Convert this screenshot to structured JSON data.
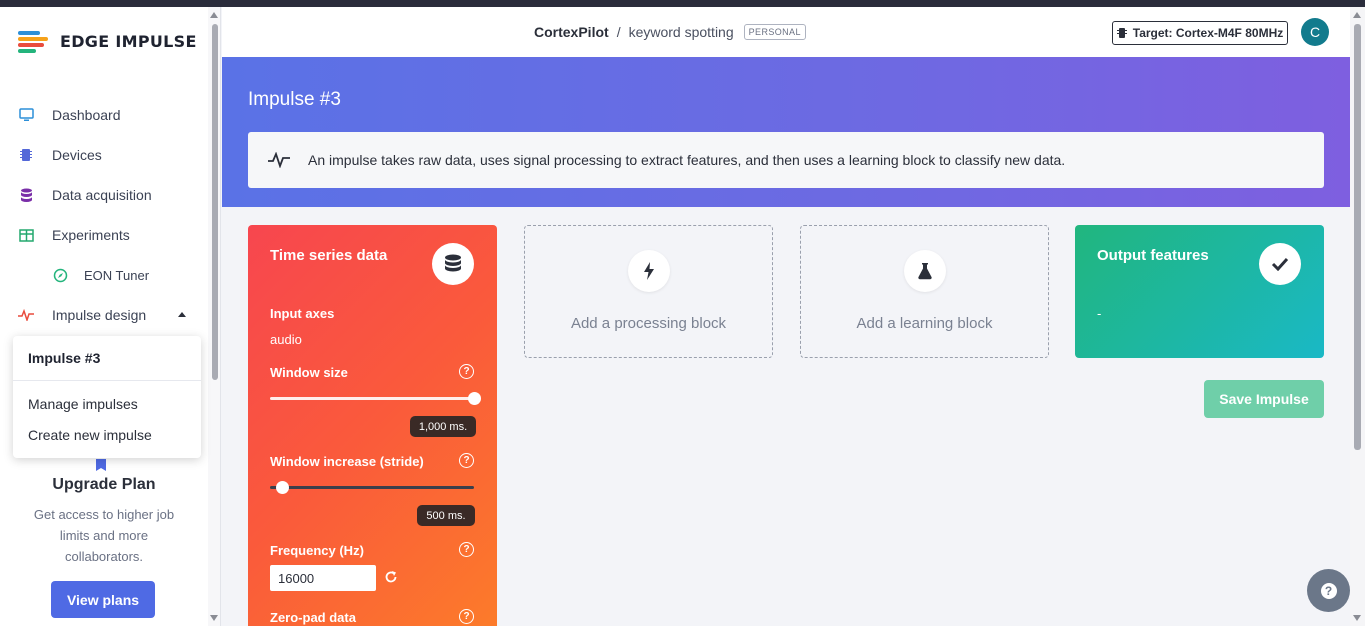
{
  "app": {
    "logo_text": "EDGE IMPULSE"
  },
  "sidebar": {
    "items": [
      {
        "label": "Dashboard",
        "icon": "monitor-icon"
      },
      {
        "label": "Devices",
        "icon": "chip-icon"
      },
      {
        "label": "Data acquisition",
        "icon": "database-icon"
      },
      {
        "label": "Experiments",
        "icon": "table-icon"
      },
      {
        "label": "EON Tuner",
        "icon": "compass-icon"
      },
      {
        "label": "Impulse design",
        "icon": "pulse-icon"
      }
    ],
    "impulse_menu": {
      "current": "Impulse #3",
      "options": [
        "Manage impulses",
        "Create new impulse"
      ]
    },
    "upgrade": {
      "title": "Upgrade Plan",
      "text": "Get access to higher job limits and more collaborators.",
      "button": "View plans"
    }
  },
  "header": {
    "project": "CortexPilot",
    "separator": "/",
    "project_name": "keyword spotting",
    "badge": "PERSONAL",
    "target": "Target: Cortex-M4F 80MHz",
    "avatar_letter": "C"
  },
  "banner": {
    "title": "Impulse #3",
    "info": "An impulse takes raw data, uses signal processing to extract features, and then uses a learning block to classify new data."
  },
  "time_series": {
    "title": "Time series data",
    "input_axes_label": "Input axes",
    "input_axes_value": "audio",
    "window_size_label": "Window size",
    "window_size_value": "1,000 ms.",
    "window_size_fraction": 1.0,
    "window_increase_label": "Window increase (stride)",
    "window_increase_value": "500 ms.",
    "window_increase_fraction": 0.06,
    "frequency_label": "Frequency (Hz)",
    "frequency_value": "16000",
    "zero_pad_label": "Zero-pad data",
    "help_glyph": "?"
  },
  "processing": {
    "label": "Add a processing block"
  },
  "learning": {
    "label": "Add a learning block"
  },
  "output": {
    "title": "Output features",
    "value": "-"
  },
  "actions": {
    "save": "Save Impulse"
  },
  "colors": {
    "accent": "#4f6ae4",
    "time_series_start": "#f7464f",
    "time_series_end": "#fc7b2a",
    "output_start": "#21b67e",
    "output_end": "#1ab8c6",
    "save_button": "#6fcfa9"
  }
}
